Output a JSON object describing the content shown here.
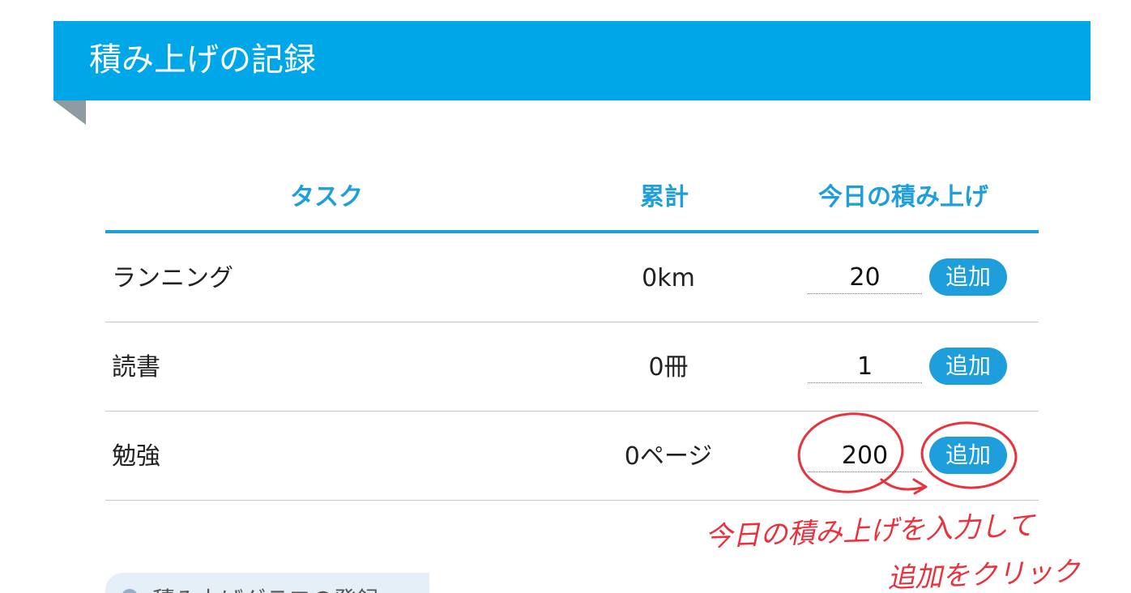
{
  "header": {
    "title": "積み上げの記録"
  },
  "table": {
    "columns": {
      "task": "タスク",
      "total": "累計",
      "today": "今日の積み上げ"
    },
    "rows": [
      {
        "task": "ランニング",
        "total": "0km",
        "today_value": "20",
        "add_label": "追加"
      },
      {
        "task": "読書",
        "total": "0冊",
        "today_value": "1",
        "add_label": "追加"
      },
      {
        "task": "勉強",
        "total": "0ページ",
        "today_value": "200",
        "add_label": "追加"
      }
    ]
  },
  "partial_section": {
    "text": "積み上げグラフの登録"
  },
  "annotation": {
    "line1": "今日の積み上げを入力して",
    "line2": "追加をクリック",
    "color": "#e8323c"
  },
  "colors": {
    "banner": "#00a7e8",
    "accent": "#1e9fdb"
  }
}
